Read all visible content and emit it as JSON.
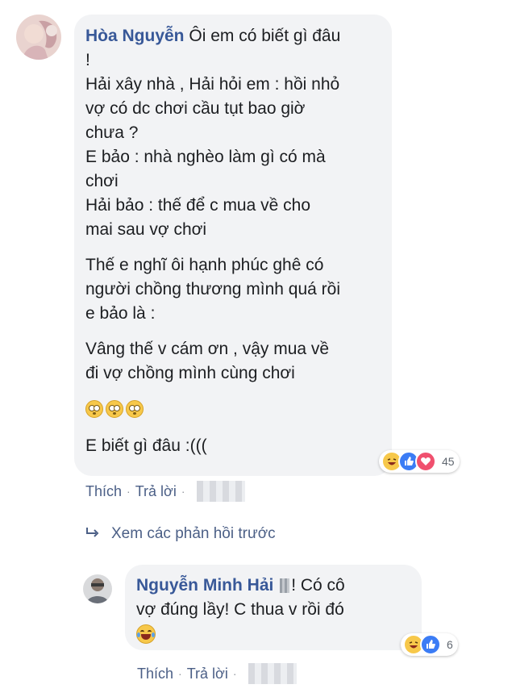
{
  "comment1": {
    "author": "Hòa Nguyễn",
    "lines": [
      "Ôi em có biết gì đâu",
      "!",
      "Hải xây nhà , Hải hỏi em : hồi nhỏ",
      "vợ có dc chơi cầu tụt bao giờ",
      "chưa ?",
      "E bảo : nhà nghèo làm gì có mà",
      "chơi",
      "Hải bảo : thế để c mua về cho",
      "mai sau vợ chơi",
      "Thế e nghĩ ôi hạnh phúc ghê có",
      "người chồng thương mình quá rồi",
      "e bảo là :",
      "Vâng thế v cám ơn , vậy mua về",
      "đi vợ chồng mình cùng chơi",
      "E biết gì đâu :((("
    ],
    "emoji_icons": [
      "flushed-face-icon",
      "flushed-face-icon",
      "flushed-face-icon"
    ],
    "reaction_icons": [
      "haha-icon",
      "like-icon",
      "love-icon"
    ],
    "reaction_count": "45",
    "like_label": "Thích",
    "reply_label": "Trả lời",
    "separator": "·"
  },
  "view_previous": {
    "label": "Xem các phản hồi trước",
    "icon": "reply-arrow-icon"
  },
  "comment2": {
    "author": "Nguyễn Minh Hải",
    "line1": "! Có cô",
    "line2": "vợ đúng lầy! C thua v rồi đó",
    "emoji_icon": "tears-of-joy-icon",
    "reaction_icons": [
      "haha-icon",
      "like-icon"
    ],
    "reaction_count": "6",
    "like_label": "Thích",
    "reply_label": "Trả lời",
    "separator": "·"
  },
  "colors": {
    "link": "#385898",
    "bubble": "#f2f3f5",
    "action": "#4b5f86"
  }
}
